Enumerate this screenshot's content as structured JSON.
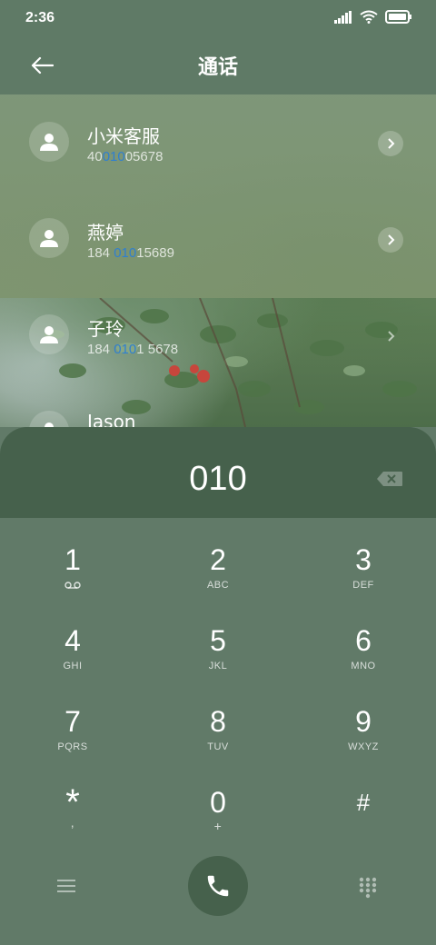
{
  "status_bar": {
    "time": "2:36"
  },
  "header": {
    "title": "通话"
  },
  "contacts": [
    {
      "name": "小米客服",
      "number_pre": "40",
      "number_match": "010",
      "number_post": "05678"
    },
    {
      "name": "燕婷",
      "number_pre": "184 ",
      "number_match": "010",
      "number_post": "15689"
    },
    {
      "name": "子玲",
      "number_pre": "184 ",
      "number_match": "010",
      "number_post": "1 5678"
    },
    {
      "name": "Jason",
      "number_pre": "",
      "number_match": "",
      "number_post": ""
    }
  ],
  "dial": {
    "number": "010"
  },
  "keypad": [
    {
      "digit": "1",
      "letters": ""
    },
    {
      "digit": "2",
      "letters": "ABC"
    },
    {
      "digit": "3",
      "letters": "DEF"
    },
    {
      "digit": "4",
      "letters": "GHI"
    },
    {
      "digit": "5",
      "letters": "JKL"
    },
    {
      "digit": "6",
      "letters": "MNO"
    },
    {
      "digit": "7",
      "letters": "PQRS"
    },
    {
      "digit": "8",
      "letters": "TUV"
    },
    {
      "digit": "9",
      "letters": "WXYZ"
    },
    {
      "digit": "*",
      "letters": ","
    },
    {
      "digit": "0",
      "letters": "+"
    },
    {
      "digit": "#",
      "letters": ""
    }
  ],
  "icons": {
    "back": "arrow-left-icon",
    "avatar": "person-icon",
    "chevron": "chevron-right-icon",
    "backspace": "backspace-icon",
    "voicemail": "voicemail-icon",
    "menu": "menu-icon",
    "call": "phone-icon",
    "dialpad": "dialpad-icon"
  },
  "colors": {
    "accent_match": "#2f7fd0",
    "dial_panel": "#46614c",
    "keypad_bg": "#617a68"
  }
}
